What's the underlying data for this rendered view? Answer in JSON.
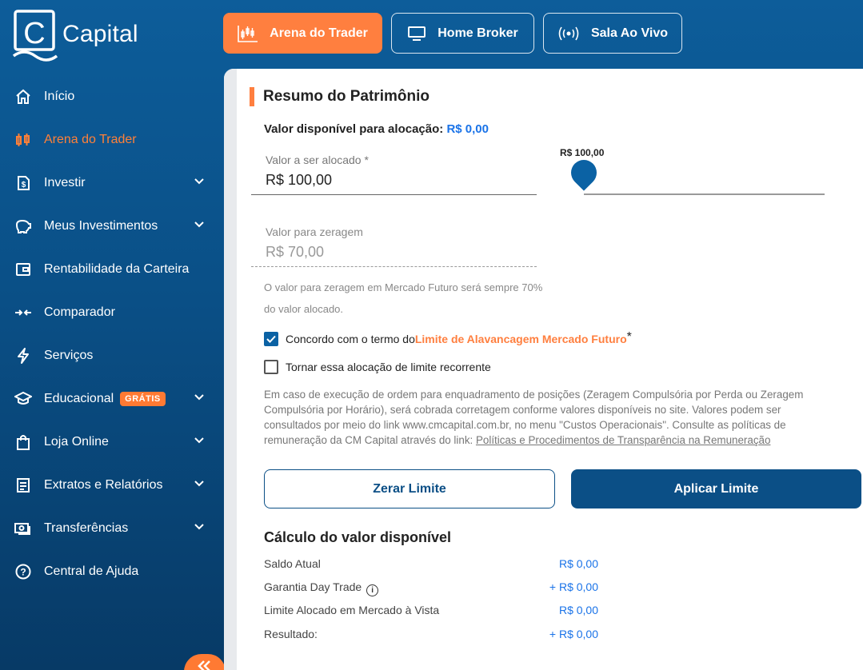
{
  "brand": {
    "name": "Capital"
  },
  "top_tabs": [
    {
      "label": "Arena do Trader",
      "icon": "candlestick-chart-icon",
      "active": true
    },
    {
      "label": "Home Broker",
      "icon": "monitor-icon",
      "active": false
    },
    {
      "label": "Sala Ao Vivo",
      "icon": "broadcast-icon",
      "active": false
    }
  ],
  "sidebar": {
    "items": [
      {
        "label": "Início",
        "icon": "home-icon",
        "expandable": false
      },
      {
        "label": "Arena do Trader",
        "icon": "candlestick-chart-icon",
        "expandable": false,
        "active": true
      },
      {
        "label": "Investir",
        "icon": "document-dollar-icon",
        "expandable": true
      },
      {
        "label": "Meus Investimentos",
        "icon": "piggy-bank-icon",
        "expandable": true
      },
      {
        "label": "Rentabilidade da Carteira",
        "icon": "wallet-icon",
        "expandable": false
      },
      {
        "label": "Comparador",
        "icon": "compare-arrows-icon",
        "expandable": false
      },
      {
        "label": "Serviços",
        "icon": "lightning-icon",
        "expandable": false
      },
      {
        "label": "Educacional",
        "icon": "graduation-cap-icon",
        "expandable": true,
        "badge": "GRÁTIS"
      },
      {
        "label": "Loja Online",
        "icon": "shopping-bag-icon",
        "expandable": true
      },
      {
        "label": "Extratos e Relatórios",
        "icon": "report-icon",
        "expandable": true
      },
      {
        "label": "Transferências",
        "icon": "money-transfer-icon",
        "expandable": true
      },
      {
        "label": "Central de Ajuda",
        "icon": "help-circle-icon",
        "expandable": false
      }
    ]
  },
  "main": {
    "title": "Resumo do Patrimônio",
    "available_label": "Valor disponível para alocação:",
    "available_value": "R$ 0,00",
    "allocate_field": {
      "label": "Valor a ser alocado *",
      "value": "R$ 100,00"
    },
    "slider": {
      "value_label": "R$ 100,00",
      "level": 0
    },
    "zero_field": {
      "label": "Valor para zeragem",
      "value": "R$ 70,00"
    },
    "hint_line1": "O valor para zeragem em Mercado Futuro será sempre 70%",
    "hint_line2": "do valor alocado.",
    "agree": {
      "prefix": "Concordo com o termo do ",
      "link": "Limite de Alavancagem Mercado Futuro",
      "suffix": "*",
      "checked": true
    },
    "recurring": {
      "label": "Tornar essa alocação de limite recorrente",
      "checked": false
    },
    "disclaimer_text": "Em caso de execução de ordem para enquadramento de posições (Zeragem Compulsória por Perda ou Zeragem Compulsória por Horário), será cobrada corretagem conforme valores disponíveis no site. Valores podem ser consultados por meio do link www.cmcapital.com.br, no menu \"Custos Operacionais\". Consulte as políticas de remuneração da CM Capital através do link: ",
    "disclaimer_link": "Políticas e Procedimentos de Transparência na Remuneração",
    "btn_zerar": "Zerar Limite",
    "btn_aplicar": "Aplicar Limite",
    "calc": {
      "title": "Cálculo do valor disponível",
      "rows": [
        {
          "label": "Saldo Atual",
          "value": "R$ 0,00"
        },
        {
          "label": "Garantia Day Trade",
          "value": "+ R$ 0,00"
        },
        {
          "label": "Limite Alocado em Mercado à Vista",
          "value": "R$ 0,00"
        },
        {
          "label": "Resultado:",
          "value": "+ R$ 0,00"
        }
      ]
    }
  },
  "colors": {
    "accent_orange": "#ff7f3f",
    "navy": "#0b4f86",
    "link_blue": "#1a73e8"
  }
}
